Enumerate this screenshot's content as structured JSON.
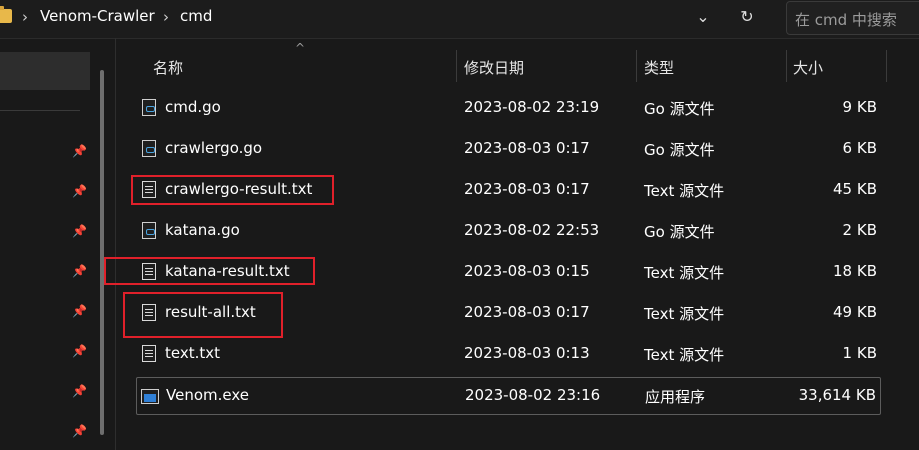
{
  "breadcrumb": {
    "items": [
      "Venom-Crawler",
      "cmd"
    ],
    "separator": "›"
  },
  "address_bar": {
    "dropdown_icon": "chevron-down-icon",
    "refresh_icon": "refresh-icon"
  },
  "search": {
    "placeholder": "在 cmd 中搜索"
  },
  "columns": {
    "name": "名称",
    "modified": "修改日期",
    "type": "类型",
    "size": "大小",
    "sort_icon": "sort-ascending-icon"
  },
  "files": [
    {
      "name": "cmd.go",
      "modified": "2023-08-02 23:19",
      "type": "Go 源文件",
      "size": "9 KB",
      "icon": "go-file-icon"
    },
    {
      "name": "crawlergo.go",
      "modified": "2023-08-03 0:17",
      "type": "Go 源文件",
      "size": "6 KB",
      "icon": "go-file-icon"
    },
    {
      "name": "crawlergo-result.txt",
      "modified": "2023-08-03 0:17",
      "type": "Text 源文件",
      "size": "45 KB",
      "icon": "text-file-icon",
      "highlighted": true
    },
    {
      "name": "katana.go",
      "modified": "2023-08-02 22:53",
      "type": "Go 源文件",
      "size": "2 KB",
      "icon": "go-file-icon"
    },
    {
      "name": "katana-result.txt",
      "modified": "2023-08-03 0:15",
      "type": "Text 源文件",
      "size": "18 KB",
      "icon": "text-file-icon",
      "highlighted": true
    },
    {
      "name": "result-all.txt",
      "modified": "2023-08-03 0:17",
      "type": "Text 源文件",
      "size": "49 KB",
      "icon": "text-file-icon",
      "highlighted": true
    },
    {
      "name": "text.txt",
      "modified": "2023-08-03 0:13",
      "type": "Text 源文件",
      "size": "1 KB",
      "icon": "text-file-icon"
    },
    {
      "name": "Venom.exe",
      "modified": "2023-08-02 23:16",
      "type": "应用程序",
      "size": "33,614 KB",
      "icon": "exe-file-icon",
      "selected": true
    }
  ],
  "nav": {
    "pin_icon": "pin-icon",
    "pinned_count": 8
  },
  "colors": {
    "background": "#191919",
    "highlight_box": "#e0202a",
    "text": "#ffffff"
  }
}
